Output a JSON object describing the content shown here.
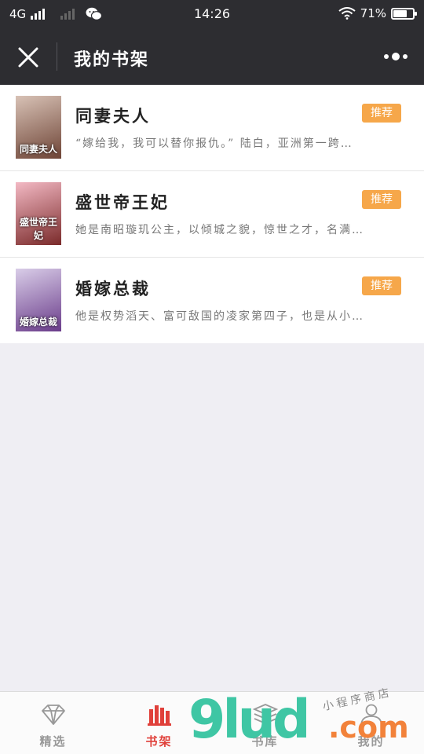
{
  "status_bar": {
    "network": "4G",
    "time": "14:26",
    "battery": "71%",
    "battery_level": 0.71
  },
  "header": {
    "title": "我的书架"
  },
  "books": [
    {
      "cover_text": "同妻夫人",
      "title": "同妻夫人",
      "badge": "推荐",
      "summary": "“嫁给我，我可以替你报仇。” 陆白，亚洲第一跨…",
      "cover_colors": [
        "#d8c2b6",
        "#6e4436"
      ]
    },
    {
      "cover_text": "盛世帝王妃",
      "title": "盛世帝王妃",
      "badge": "推荐",
      "summary": "她是南昭璇玑公主，以倾城之貌，惊世之才，名满…",
      "cover_colors": [
        "#f3b9c4",
        "#7a2a2a"
      ]
    },
    {
      "cover_text": "婚嫁总裁",
      "title": "婚嫁总裁",
      "badge": "推荐",
      "summary": "他是权势滔天、富可敌国的凌家第四子，也是从小…",
      "cover_colors": [
        "#d9cde8",
        "#6a3c8a"
      ]
    }
  ],
  "tabs": [
    {
      "label": "精选",
      "icon": "diamond-icon",
      "active": false
    },
    {
      "label": "书架",
      "icon": "bookshelf-icon",
      "active": true
    },
    {
      "label": "书库",
      "icon": "library-icon",
      "active": false
    },
    {
      "label": "我的",
      "icon": "user-icon",
      "active": false
    }
  ],
  "watermark": {
    "number": "9lud",
    "domain": ".com",
    "subtitle": "小程序商店"
  },
  "colors": {
    "header_bg": "#2d2d31",
    "badge": "#f6a74a",
    "active_tab": "#e0403a",
    "page_bg": "#efeef3"
  }
}
